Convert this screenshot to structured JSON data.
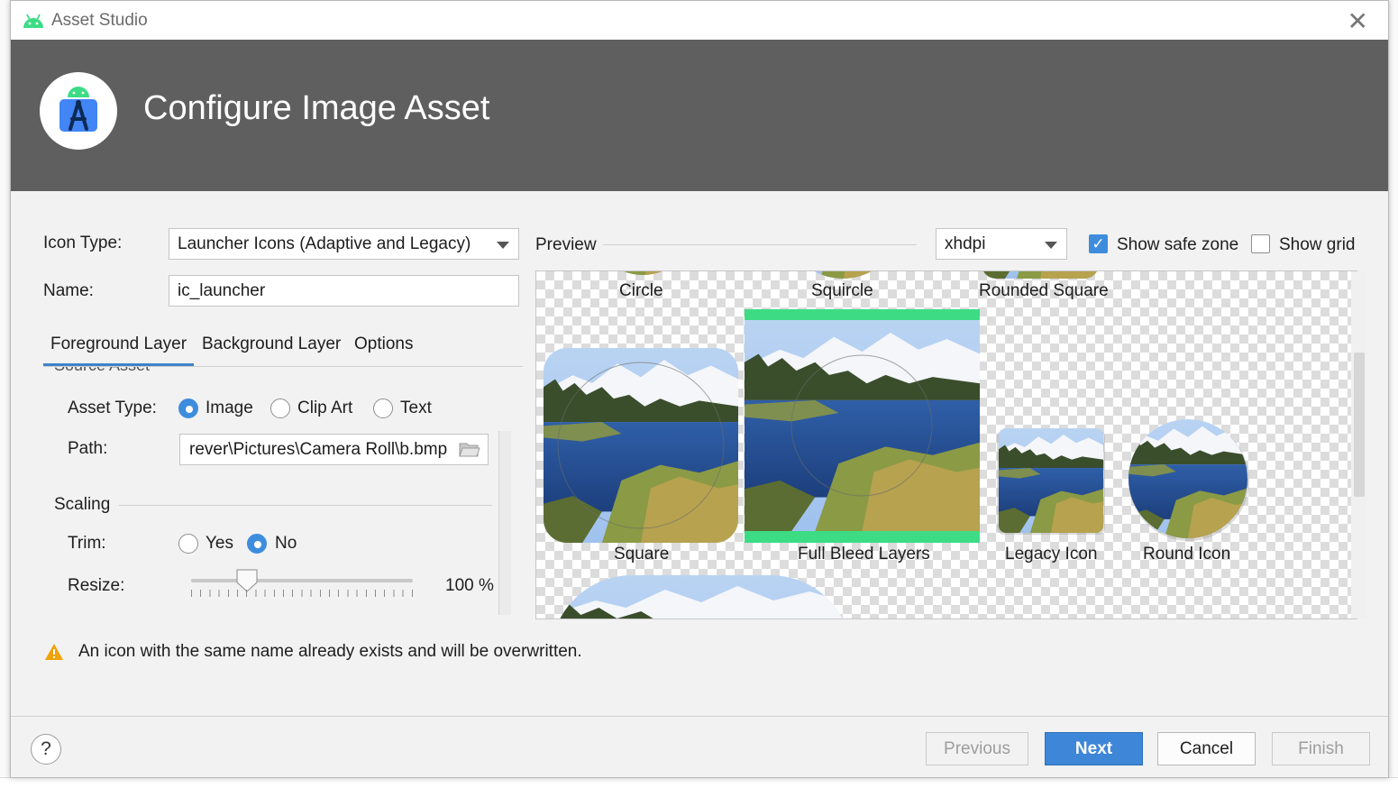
{
  "window": {
    "title": "Asset Studio",
    "close_glyph": "✕"
  },
  "banner": {
    "heading": "Configure Image Asset"
  },
  "form": {
    "icon_type_label": "Icon Type:",
    "icon_type_value": "Launcher Icons (Adaptive and Legacy)",
    "name_label": "Name:",
    "name_value": "ic_launcher"
  },
  "tabs": [
    {
      "label": "Foreground Layer"
    },
    {
      "label": "Background Layer"
    },
    {
      "label": "Options"
    }
  ],
  "source_asset": {
    "header_fragment": "Source Asset",
    "asset_type_label": "Asset Type:",
    "asset_type_options": [
      "Image",
      "Clip Art",
      "Text"
    ],
    "asset_type_selected": "Image",
    "path_label": "Path:",
    "path_value": "rever\\Pictures\\Camera Roll\\b.bmp"
  },
  "scaling": {
    "section_label": "Scaling",
    "trim_label": "Trim:",
    "trim_options": [
      "Yes",
      "No"
    ],
    "trim_selected": "No",
    "resize_label": "Resize:",
    "resize_value_text": "100 %",
    "resize_value": 100
  },
  "preview": {
    "label": "Preview",
    "density_value": "xhdpi",
    "show_safe_zone_label": "Show safe zone",
    "show_safe_zone_checked": true,
    "show_grid_label": "Show grid",
    "show_grid_checked": false,
    "shape_labels": [
      "Circle",
      "Squircle",
      "Rounded Square",
      "Square",
      "Full Bleed Layers",
      "Legacy Icon",
      "Round Icon"
    ]
  },
  "warning": {
    "text": "An icon with the same name already exists and will be overwritten."
  },
  "footer": {
    "help_glyph": "?",
    "previous_label": "Previous",
    "next_label": "Next",
    "cancel_label": "Cancel",
    "finish_label": "Finish"
  },
  "colors": {
    "accent": "#3d86d8",
    "banner_bg": "#5f5f5f",
    "android_green": "#3ddc84",
    "warning": "#f0a30a"
  }
}
